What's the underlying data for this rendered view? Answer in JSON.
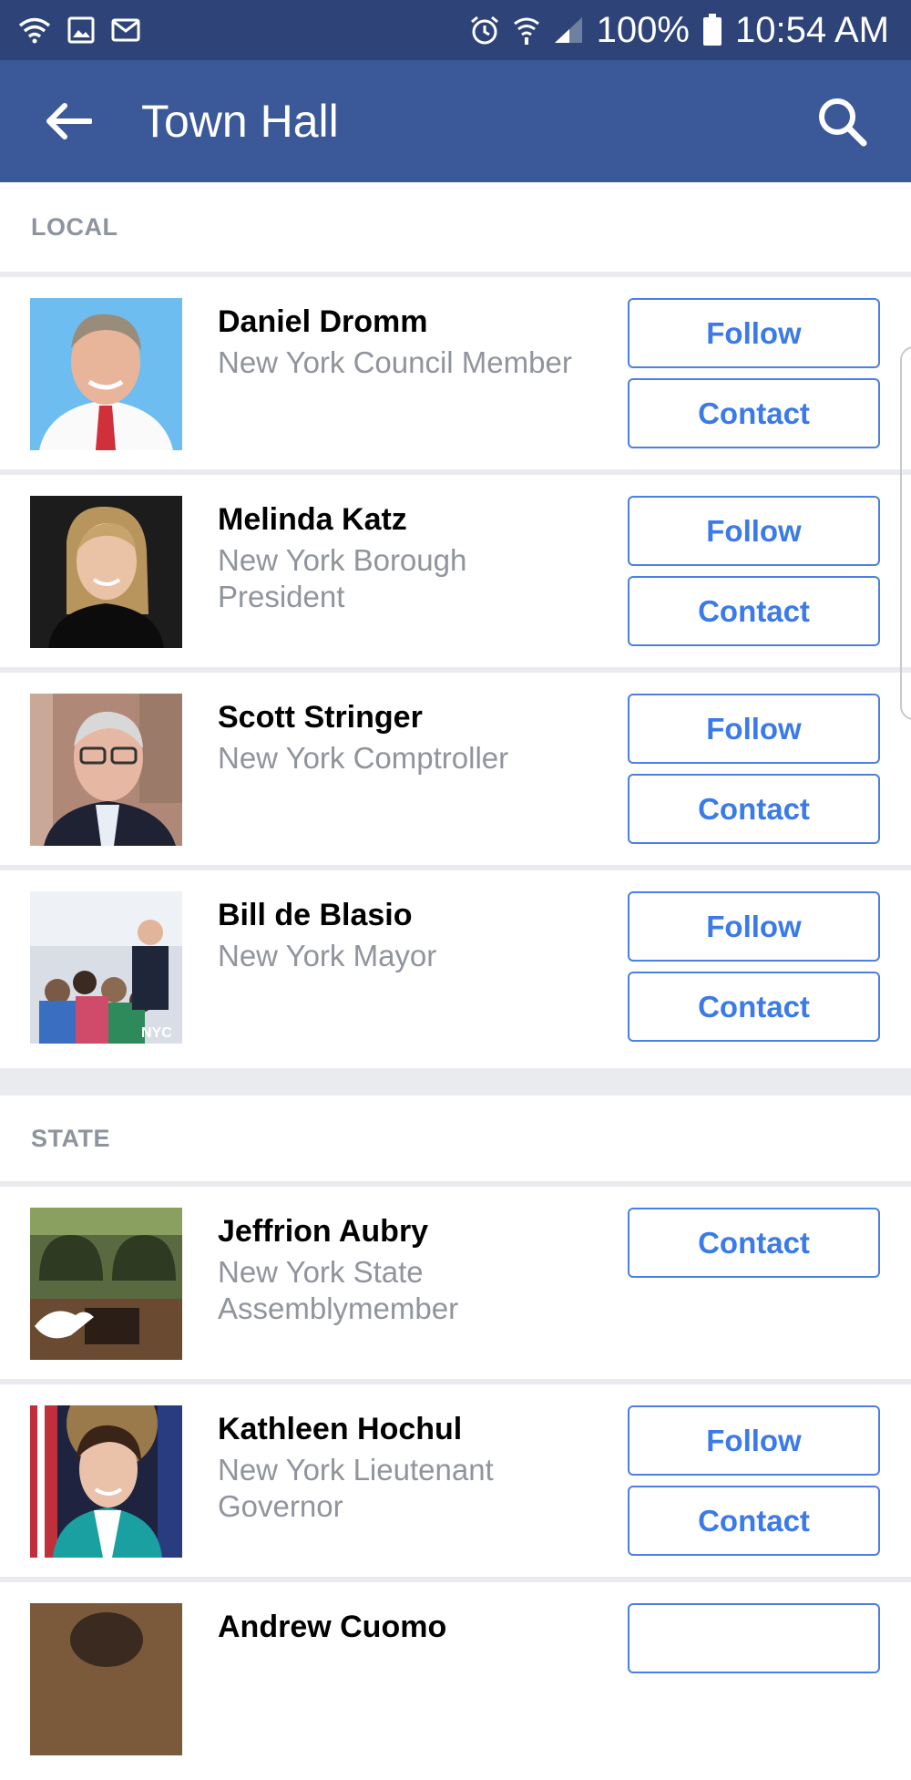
{
  "status_bar": {
    "battery": "100%",
    "time": "10:54 AM",
    "left_icons": [
      "wifi-icon",
      "image-icon",
      "mail-icon"
    ],
    "right_icons": [
      "alarm-icon",
      "wifi-call-icon",
      "signal-icon",
      "battery-icon"
    ]
  },
  "app_bar": {
    "title": "Town Hall",
    "back_icon": "arrow-left-icon",
    "search_icon": "search-icon",
    "color": "#3b5998"
  },
  "sections": [
    {
      "label": "LOCAL",
      "people": [
        {
          "name": "Daniel Dromm",
          "title": "New York Council Member",
          "follow": "Follow",
          "contact": "Contact"
        },
        {
          "name": "Melinda Katz",
          "title": "New York Borough President",
          "follow": "Follow",
          "contact": "Contact"
        },
        {
          "name": "Scott Stringer",
          "title": "New York Comptroller",
          "follow": "Follow",
          "contact": "Contact"
        },
        {
          "name": "Bill de Blasio",
          "title": "New York Mayor",
          "follow": "Follow",
          "contact": "Contact"
        }
      ]
    },
    {
      "label": "STATE",
      "people": [
        {
          "name": "Jeffrion Aubry",
          "title": "New York State Assemblymember",
          "contact": "Contact"
        },
        {
          "name": "Kathleen Hochul",
          "title": "New York Lieutenant Governor",
          "follow": "Follow",
          "contact": "Contact"
        },
        {
          "name": "Andrew Cuomo"
        }
      ]
    }
  ],
  "colors": {
    "accent": "#3b7ae8",
    "status_bar": "#2e4479",
    "section_label": "#8d949e",
    "subtitle": "#90949c",
    "divider": "#e9ebee"
  }
}
